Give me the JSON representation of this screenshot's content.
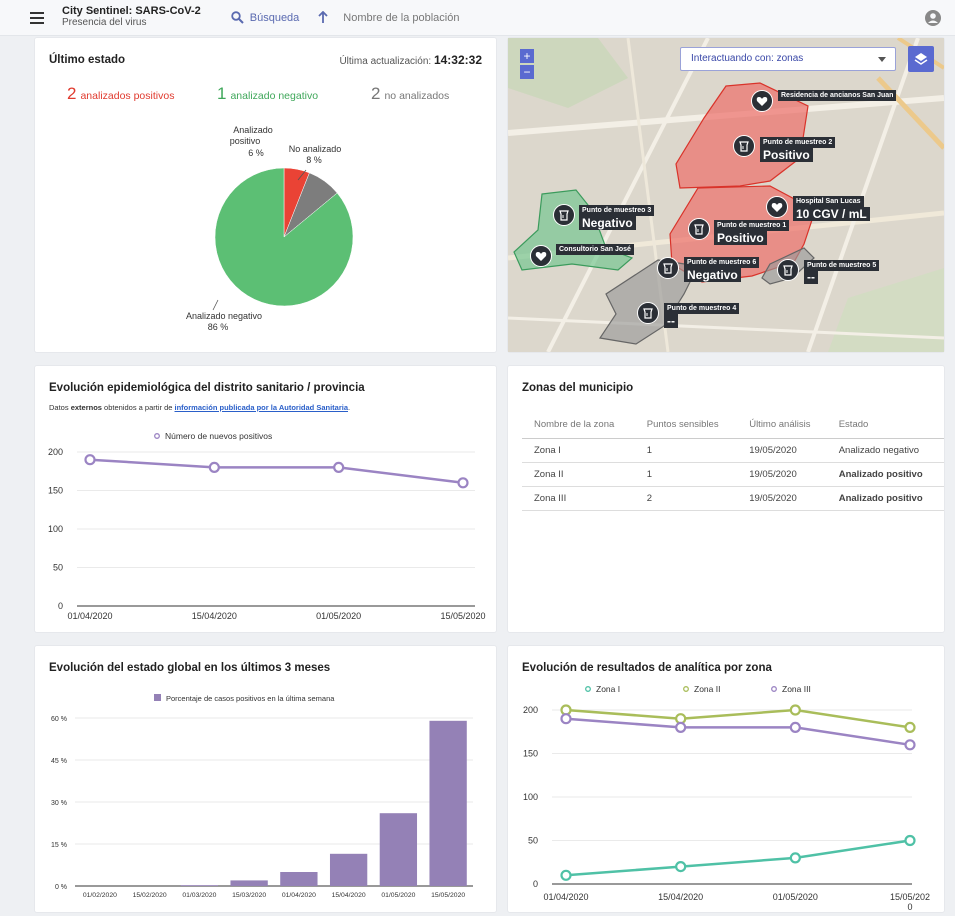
{
  "header": {
    "app_title": "City Sentinel: SARS-CoV-2",
    "subtitle": "Presencia del virus",
    "search_label": "Búsqueda",
    "population_label": "Nombre de la población",
    "icons": [
      "menu-icon",
      "search-icon",
      "arrow-up-icon",
      "user-icon"
    ]
  },
  "status_card": {
    "title": "Último estado",
    "updated_label": "Última actualización:",
    "updated_time": "14:32:32",
    "stats": [
      {
        "num": "2",
        "label": "analizados positivos",
        "color": "#e03a2e"
      },
      {
        "num": "1",
        "label": "analizado negativo",
        "color": "#3fa75a"
      },
      {
        "num": "2",
        "label": "no analizados",
        "color": "#777777"
      }
    ],
    "pie_labels": {
      "positive_1": "Analizado",
      "positive_2": "positivo",
      "positive_pct": "6 %",
      "not_1": "No analizado",
      "not_pct": "8 %",
      "negative_1": "Analizado negativo",
      "negative_pct": "86 %"
    }
  },
  "map": {
    "zoom_in": "+",
    "zoom_out": "−",
    "select_value": "Interactuando con: zonas",
    "markers": [
      {
        "label": "Residencia de ancianos San Juan",
        "value": ""
      },
      {
        "label": "Punto de muestreo 2",
        "value": "Positivo"
      },
      {
        "label": "Hospital San Lucas",
        "value": "10 CGV / mL"
      },
      {
        "label": "Punto de muestreo 3",
        "value": "Negativo"
      },
      {
        "label": "Punto de muestreo 1",
        "value": "Positivo"
      },
      {
        "label": "Consultorio San José",
        "value": ""
      },
      {
        "label": "Punto de muestreo 6",
        "value": "Negativo"
      },
      {
        "label": "Punto de muestreo 5",
        "value": "--"
      },
      {
        "label": "Punto de muestreo 4",
        "value": "--"
      }
    ]
  },
  "epi_card": {
    "title": "Evolución epidemiológica del distrito sanitario / provincia",
    "source_prefix": "Datos ",
    "source_bold": "externos",
    "source_mid": " obtenidos a partir de ",
    "source_link": "información publicada por la Autoridad Sanitaria",
    "source_end": "."
  },
  "zones_card": {
    "title": "Zonas del municipio",
    "columns": [
      "Nombre de la zona",
      "Puntos sensibles",
      "Último análisis",
      "Estado"
    ],
    "rows": [
      {
        "name": "Zona I",
        "points": "1",
        "date": "19/05/2020",
        "status": "Analizado negativo"
      },
      {
        "name": "Zona II",
        "points": "1",
        "date": "19/05/2020",
        "status": "Analizado positivo"
      },
      {
        "name": "Zona III",
        "points": "2",
        "date": "19/05/2020",
        "status": "Analizado positivo"
      }
    ]
  },
  "global_card": {
    "title": "Evolución del estado global en los últimos 3 meses"
  },
  "zone_results_card": {
    "title": "Evolución de resultados de analítica por zona"
  },
  "chart_data": [
    {
      "type": "pie",
      "categories": [
        "Analizado positivo",
        "No analizado",
        "Analizado negativo"
      ],
      "values": [
        6,
        8,
        86
      ],
      "colors": [
        "#ea4335",
        "#7d7d7d",
        "#5cbf74"
      ]
    },
    {
      "type": "line",
      "x": [
        "01/04/2020",
        "15/04/2020",
        "01/05/2020",
        "15/05/2020"
      ],
      "series": [
        {
          "name": "Número de nuevos positivos",
          "values": [
            190,
            180,
            180,
            160
          ],
          "color": "#9b84c3"
        }
      ],
      "ylim": [
        0,
        200
      ],
      "yticks": [
        "0",
        "50",
        "100",
        "150",
        "200"
      ],
      "legend": "top"
    },
    {
      "type": "bar",
      "categories": [
        "01/02/2020",
        "15/02/2020",
        "01/03/2020",
        "15/03/2020",
        "01/04/2020",
        "15/04/2020",
        "01/05/2020",
        "15/05/2020"
      ],
      "series": [
        {
          "name": "Porcentaje de casos positivos en la última semana",
          "values": [
            0,
            0,
            0.3,
            2,
            5,
            11.5,
            26,
            59
          ],
          "color": "#9481b6"
        }
      ],
      "ylim": [
        0,
        60
      ],
      "yticks": [
        "0 %",
        "15 %",
        "30 %",
        "45 %",
        "60 %"
      ],
      "legend": "top"
    },
    {
      "type": "line",
      "x": [
        "01/04/2020",
        "15/04/2020",
        "01/05/2020",
        "15/05/202 0"
      ],
      "series": [
        {
          "name": "Zona I",
          "values": [
            10,
            20,
            30,
            50
          ],
          "color": "#4fc1a6"
        },
        {
          "name": "Zona II",
          "values": [
            200,
            190,
            200,
            180
          ],
          "color": "#a9bd5a"
        },
        {
          "name": "Zona III",
          "values": [
            190,
            180,
            180,
            160
          ],
          "color": "#9b84c3"
        }
      ],
      "ylim": [
        0,
        200
      ],
      "yticks": [
        "0",
        "50",
        "100",
        "150",
        "200"
      ],
      "legend": "top"
    }
  ]
}
